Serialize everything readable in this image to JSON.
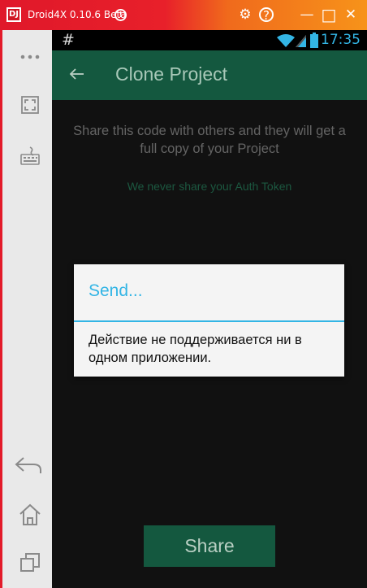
{
  "window": {
    "logo_text": "DJ",
    "title": "Droid4X 0.10.6 Beta",
    "info_icon_glyph": "!",
    "buttons": [
      {
        "name": "settings-icon",
        "glyph": "⚙"
      },
      {
        "name": "help-icon",
        "glyph": "?"
      },
      {
        "name": "minimize-icon",
        "glyph": "—"
      },
      {
        "name": "maximize-icon",
        "glyph": "□"
      },
      {
        "name": "close-icon",
        "glyph": "✕"
      }
    ]
  },
  "sidebar": {
    "icons": [
      "more-icon",
      "fullscreen-icon",
      "keyboard-icon",
      "back-icon",
      "home-icon",
      "recent-apps-icon"
    ]
  },
  "status_bar": {
    "left_glyph": "#",
    "time": "17:35",
    "icons": [
      "wifi-icon",
      "signal-icon",
      "battery-icon"
    ]
  },
  "app_bar": {
    "title": "Clone Project"
  },
  "content": {
    "share_text": "Share this code with others and they will get a full copy of your Project",
    "auth_note": "We never share your Auth Token",
    "share_button": "Share"
  },
  "dialog": {
    "title": "Send...",
    "message": "Действие не поддерживается ни в одном приложении."
  },
  "colors": {
    "accent": "#33b5e5",
    "app_green": "#14583f",
    "title_bar_red": "#e0182a",
    "title_bar_orange": "#f7931a"
  }
}
